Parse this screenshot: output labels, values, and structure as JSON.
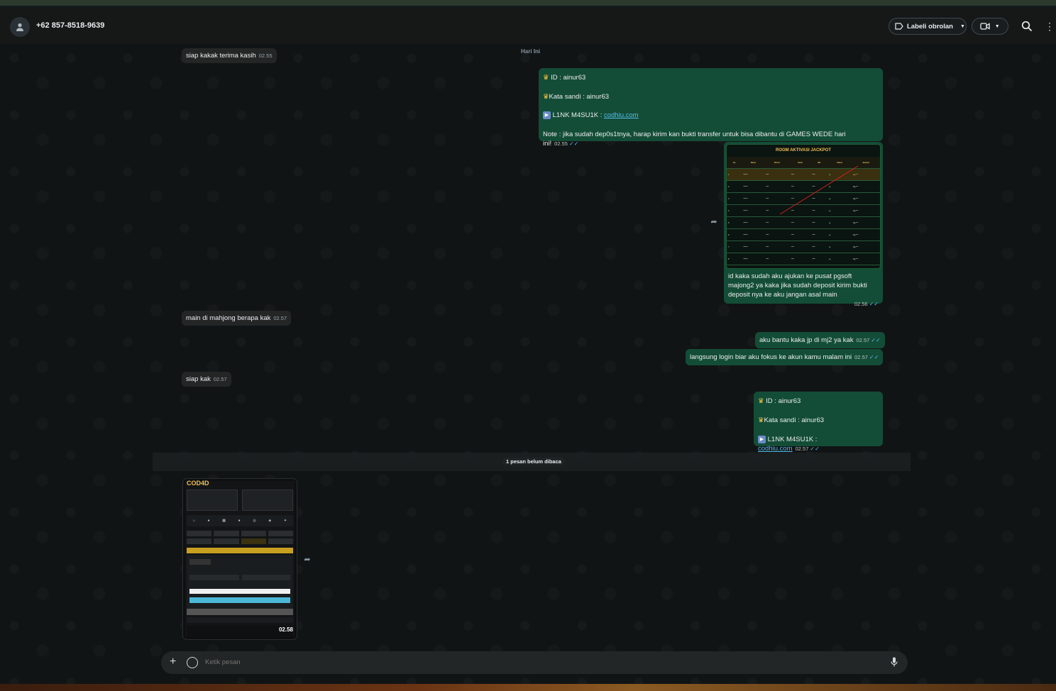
{
  "header": {
    "contact_name": "+62 857-8518-9639",
    "label_button": "Labeli obrolan",
    "icons": [
      "person-icon",
      "label-icon",
      "video-call-icon",
      "chevron-down-icon",
      "search-icon",
      "menu-icon"
    ]
  },
  "chat": {
    "date_chip": "Hari Ini",
    "unread_label": "1 pesan belum dibaca",
    "messages": [
      {
        "dir": "in",
        "text": "siap kakak terima kasih",
        "time": "02.55"
      },
      {
        "dir": "out",
        "lines": [
          "ID :  ainur63",
          "Kata sandi : ainur63",
          "L1NK M4SU1K : ",
          "Note : jika sudah dep0s1tnya, harap kirim kan bukti transfer untuk bisa dibantu di GAMES WEDE hari ini!"
        ],
        "link": "codhiu.com",
        "time": "02.55"
      },
      {
        "dir": "out",
        "image_title": "ROOM AKTIVASI JACKPOT",
        "caption": "id kaka sudah aku ajukan ke pusat pgsoft majong2 ya kaka jika sudah deposit kirim bukti deposit nya ke aku jangan asal main",
        "time": "02.56"
      },
      {
        "dir": "in",
        "text": "main di mahjong berapa kak",
        "time": "02.57"
      },
      {
        "dir": "out",
        "text": "aku bantu kaka jp di mj2 ya kak",
        "time": "02.57"
      },
      {
        "dir": "out",
        "text": "langsung login biar aku fokus ke akun kamu malam ini",
        "time": "02.57"
      },
      {
        "dir": "in",
        "text": "siap kak",
        "time": "02.57"
      },
      {
        "dir": "out",
        "lines": [
          "ID :  ainur63",
          "Kata sandi : ainur63",
          "L1NK M4SU1K : "
        ],
        "link": "codhiu.com",
        "time": "02.57"
      },
      {
        "dir": "in",
        "image_title": "COD4D",
        "time": "02.58"
      }
    ]
  },
  "composer": {
    "placeholder": "Ketik pesan"
  },
  "colors": {
    "outgoing_bubble": "#144d37",
    "incoming_bubble": "#242626",
    "read_ticks": "#53bdeb"
  }
}
